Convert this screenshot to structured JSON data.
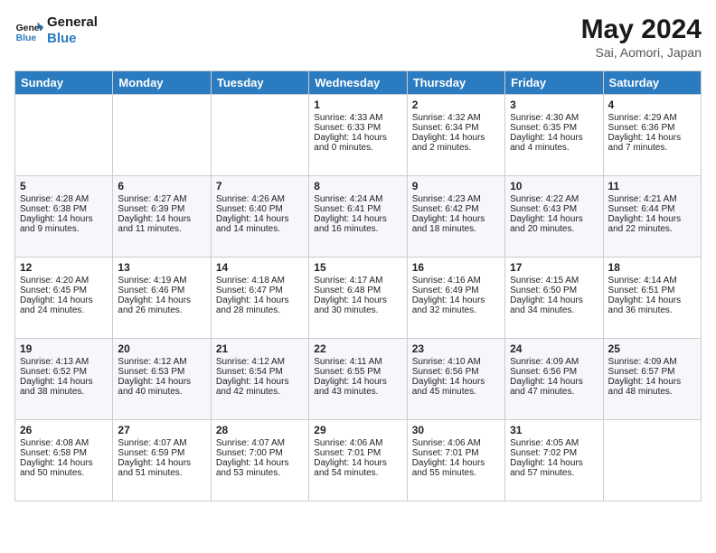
{
  "header": {
    "logo_line1": "General",
    "logo_line2": "Blue",
    "month": "May 2024",
    "location": "Sai, Aomori, Japan"
  },
  "weekdays": [
    "Sunday",
    "Monday",
    "Tuesday",
    "Wednesday",
    "Thursday",
    "Friday",
    "Saturday"
  ],
  "weeks": [
    [
      {
        "day": "",
        "info": ""
      },
      {
        "day": "",
        "info": ""
      },
      {
        "day": "",
        "info": ""
      },
      {
        "day": "1",
        "info": "Sunrise: 4:33 AM\nSunset: 6:33 PM\nDaylight: 14 hours\nand 0 minutes."
      },
      {
        "day": "2",
        "info": "Sunrise: 4:32 AM\nSunset: 6:34 PM\nDaylight: 14 hours\nand 2 minutes."
      },
      {
        "day": "3",
        "info": "Sunrise: 4:30 AM\nSunset: 6:35 PM\nDaylight: 14 hours\nand 4 minutes."
      },
      {
        "day": "4",
        "info": "Sunrise: 4:29 AM\nSunset: 6:36 PM\nDaylight: 14 hours\nand 7 minutes."
      }
    ],
    [
      {
        "day": "5",
        "info": "Sunrise: 4:28 AM\nSunset: 6:38 PM\nDaylight: 14 hours\nand 9 minutes."
      },
      {
        "day": "6",
        "info": "Sunrise: 4:27 AM\nSunset: 6:39 PM\nDaylight: 14 hours\nand 11 minutes."
      },
      {
        "day": "7",
        "info": "Sunrise: 4:26 AM\nSunset: 6:40 PM\nDaylight: 14 hours\nand 14 minutes."
      },
      {
        "day": "8",
        "info": "Sunrise: 4:24 AM\nSunset: 6:41 PM\nDaylight: 14 hours\nand 16 minutes."
      },
      {
        "day": "9",
        "info": "Sunrise: 4:23 AM\nSunset: 6:42 PM\nDaylight: 14 hours\nand 18 minutes."
      },
      {
        "day": "10",
        "info": "Sunrise: 4:22 AM\nSunset: 6:43 PM\nDaylight: 14 hours\nand 20 minutes."
      },
      {
        "day": "11",
        "info": "Sunrise: 4:21 AM\nSunset: 6:44 PM\nDaylight: 14 hours\nand 22 minutes."
      }
    ],
    [
      {
        "day": "12",
        "info": "Sunrise: 4:20 AM\nSunset: 6:45 PM\nDaylight: 14 hours\nand 24 minutes."
      },
      {
        "day": "13",
        "info": "Sunrise: 4:19 AM\nSunset: 6:46 PM\nDaylight: 14 hours\nand 26 minutes."
      },
      {
        "day": "14",
        "info": "Sunrise: 4:18 AM\nSunset: 6:47 PM\nDaylight: 14 hours\nand 28 minutes."
      },
      {
        "day": "15",
        "info": "Sunrise: 4:17 AM\nSunset: 6:48 PM\nDaylight: 14 hours\nand 30 minutes."
      },
      {
        "day": "16",
        "info": "Sunrise: 4:16 AM\nSunset: 6:49 PM\nDaylight: 14 hours\nand 32 minutes."
      },
      {
        "day": "17",
        "info": "Sunrise: 4:15 AM\nSunset: 6:50 PM\nDaylight: 14 hours\nand 34 minutes."
      },
      {
        "day": "18",
        "info": "Sunrise: 4:14 AM\nSunset: 6:51 PM\nDaylight: 14 hours\nand 36 minutes."
      }
    ],
    [
      {
        "day": "19",
        "info": "Sunrise: 4:13 AM\nSunset: 6:52 PM\nDaylight: 14 hours\nand 38 minutes."
      },
      {
        "day": "20",
        "info": "Sunrise: 4:12 AM\nSunset: 6:53 PM\nDaylight: 14 hours\nand 40 minutes."
      },
      {
        "day": "21",
        "info": "Sunrise: 4:12 AM\nSunset: 6:54 PM\nDaylight: 14 hours\nand 42 minutes."
      },
      {
        "day": "22",
        "info": "Sunrise: 4:11 AM\nSunset: 6:55 PM\nDaylight: 14 hours\nand 43 minutes."
      },
      {
        "day": "23",
        "info": "Sunrise: 4:10 AM\nSunset: 6:56 PM\nDaylight: 14 hours\nand 45 minutes."
      },
      {
        "day": "24",
        "info": "Sunrise: 4:09 AM\nSunset: 6:56 PM\nDaylight: 14 hours\nand 47 minutes."
      },
      {
        "day": "25",
        "info": "Sunrise: 4:09 AM\nSunset: 6:57 PM\nDaylight: 14 hours\nand 48 minutes."
      }
    ],
    [
      {
        "day": "26",
        "info": "Sunrise: 4:08 AM\nSunset: 6:58 PM\nDaylight: 14 hours\nand 50 minutes."
      },
      {
        "day": "27",
        "info": "Sunrise: 4:07 AM\nSunset: 6:59 PM\nDaylight: 14 hours\nand 51 minutes."
      },
      {
        "day": "28",
        "info": "Sunrise: 4:07 AM\nSunset: 7:00 PM\nDaylight: 14 hours\nand 53 minutes."
      },
      {
        "day": "29",
        "info": "Sunrise: 4:06 AM\nSunset: 7:01 PM\nDaylight: 14 hours\nand 54 minutes."
      },
      {
        "day": "30",
        "info": "Sunrise: 4:06 AM\nSunset: 7:01 PM\nDaylight: 14 hours\nand 55 minutes."
      },
      {
        "day": "31",
        "info": "Sunrise: 4:05 AM\nSunset: 7:02 PM\nDaylight: 14 hours\nand 57 minutes."
      },
      {
        "day": "",
        "info": ""
      }
    ]
  ]
}
